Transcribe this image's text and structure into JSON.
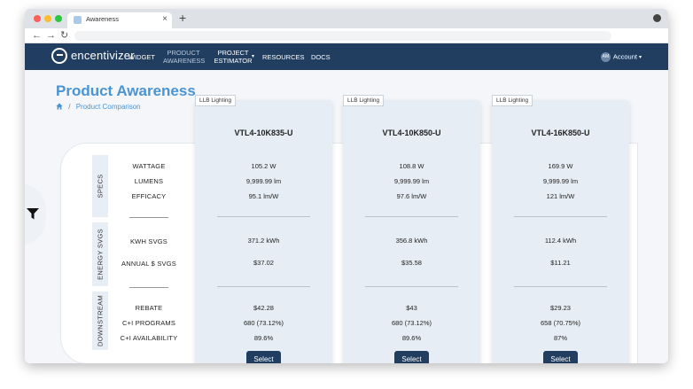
{
  "browser": {
    "tab_title": "Awareness",
    "tab_close": "×",
    "new_tab": "+",
    "back": "←",
    "forward": "→",
    "reload": "↻"
  },
  "nav": {
    "logo_text": "encentivizer",
    "items": [
      {
        "label": "WIDGET"
      },
      {
        "label": "PRODUCT AWARENESS"
      },
      {
        "label": "PROJECT ESTIMATOR"
      },
      {
        "label": "RESOURCES"
      },
      {
        "label": "DOCS"
      }
    ],
    "account_initials": "AM",
    "account_label": "Account"
  },
  "page": {
    "title": "Product Awareness",
    "breadcrumb_sep": "/",
    "breadcrumb": "Product Comparison"
  },
  "sections": {
    "specs": "SPECS",
    "energy": "ENERGY SVGS",
    "downstream": "DOWNSTREAM"
  },
  "row_labels": {
    "wattage": "WATTAGE",
    "lumens": "LUMENS",
    "efficacy": "EFFICACY",
    "kwh": "KWH SVGS",
    "annual": "ANNUAL $ SVGS",
    "rebate": "REBATE",
    "programs": "C+I PROGRAMS",
    "availability": "C+I AVAILABILITY"
  },
  "products": [
    {
      "tag": "LLB Lighting",
      "model": "VTL4-10K835-U",
      "wattage": "105.2 W",
      "lumens": "9,999.99 lm",
      "efficacy": "95.1 lm/W",
      "kwh": "371.2 kWh",
      "annual": "$37.02",
      "rebate": "$42.28",
      "programs": "680 (73.12%)",
      "availability": "89.6%",
      "select": "Select"
    },
    {
      "tag": "LLB Lighting",
      "model": "VTL4-10K850-U",
      "wattage": "108.8 W",
      "lumens": "9,999.99 lm",
      "efficacy": "97.6 lm/W",
      "kwh": "356.8 kWh",
      "annual": "$35.58",
      "rebate": "$43",
      "programs": "680 (73.12%)",
      "availability": "89.6%",
      "select": "Select"
    },
    {
      "tag": "LLB Lighting",
      "model": "VTL4-16K850-U",
      "wattage": "169.9 W",
      "lumens": "9,999.99 lm",
      "efficacy": "121 lm/W",
      "kwh": "112.4 kWh",
      "annual": "$11.21",
      "rebate": "$29.23",
      "programs": "658 (70.75%)",
      "availability": "87%",
      "select": "Select"
    }
  ],
  "colors": {
    "navbar": "#213e60",
    "accent": "#4b94d3",
    "card": "#e6edf4"
  },
  "icons": {
    "home": "home-icon",
    "filter": "filter-icon"
  }
}
